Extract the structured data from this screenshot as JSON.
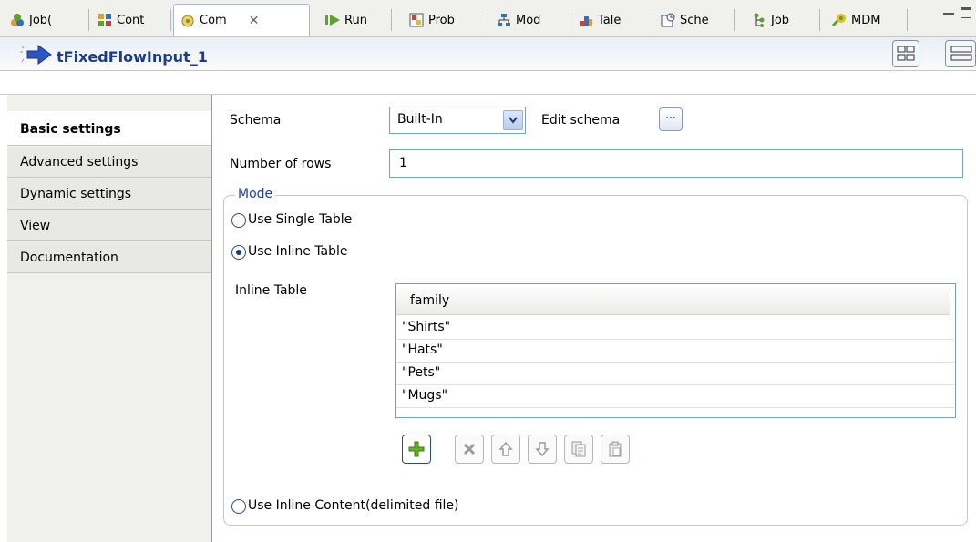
{
  "tabs": [
    {
      "label": "Job(",
      "icon": "job-icon"
    },
    {
      "label": "Cont",
      "icon": "contexts-icon"
    },
    {
      "label": "Com",
      "icon": "component-icon",
      "active": true
    },
    {
      "label": "Run",
      "icon": "run-icon"
    },
    {
      "label": "Prob",
      "icon": "problems-icon"
    },
    {
      "label": "Mod",
      "icon": "modules-icon"
    },
    {
      "label": "Tale",
      "icon": "talend-icon"
    },
    {
      "label": "Sche",
      "icon": "scheduler-icon"
    },
    {
      "label": "Job",
      "icon": "job-hierarchy-icon"
    },
    {
      "label": "MDM",
      "icon": "mdm-icon"
    }
  ],
  "component": {
    "title": "tFixedFlowInput_1"
  },
  "nav": [
    "Basic settings",
    "Advanced settings",
    "Dynamic settings",
    "View",
    "Documentation"
  ],
  "form": {
    "schema_label": "Schema",
    "schema_value": "Built-In",
    "edit_schema_label": "Edit schema",
    "edit_schema_btn": "···",
    "rows_label": "Number of rows",
    "rows_value": "1",
    "mode_label": "Mode",
    "radio_single": "Use Single Table",
    "radio_inline": "Use Inline Table",
    "inline_table_label": "Inline Table",
    "radio_content": "Use Inline Content(delimited file)",
    "selected_mode": "Use Inline Table"
  },
  "table": {
    "header": "family",
    "rows": [
      "\"Shirts\"",
      "\"Hats\"",
      "\"Pets\"",
      "\"Mugs\""
    ]
  },
  "table_buttons": [
    "add-row-button",
    "remove-row-button",
    "move-up-button",
    "move-down-button",
    "copy-button",
    "paste-button"
  ]
}
